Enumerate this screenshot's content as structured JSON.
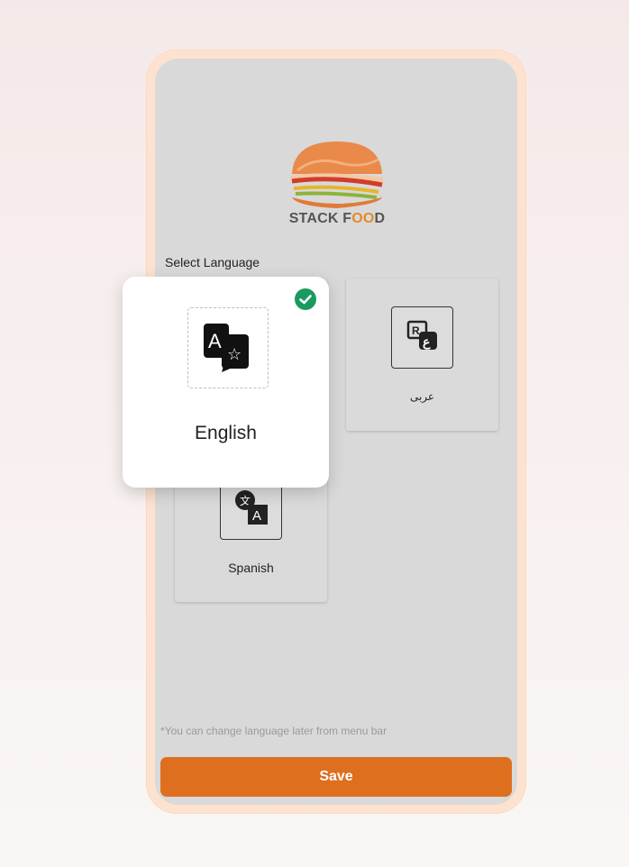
{
  "app": {
    "logo_text_start": "STACK F",
    "logo_text_oo": "OO",
    "logo_text_end": "D"
  },
  "screen": {
    "section_label": "Select Language",
    "hint": "*You can change language later from menu bar",
    "save_label": "Save"
  },
  "languages": [
    {
      "label": "English",
      "icon": "translate-icon",
      "selected": true
    },
    {
      "label": "عربى",
      "icon": "arabic-letters-icon",
      "selected": false
    },
    {
      "label": "Spanish",
      "icon": "language-icon",
      "selected": false
    }
  ],
  "colors": {
    "accent": "#de6f1f",
    "check": "#1a9a5e",
    "frame": "#fde3cf",
    "screen_bg": "#d9d9d9"
  }
}
